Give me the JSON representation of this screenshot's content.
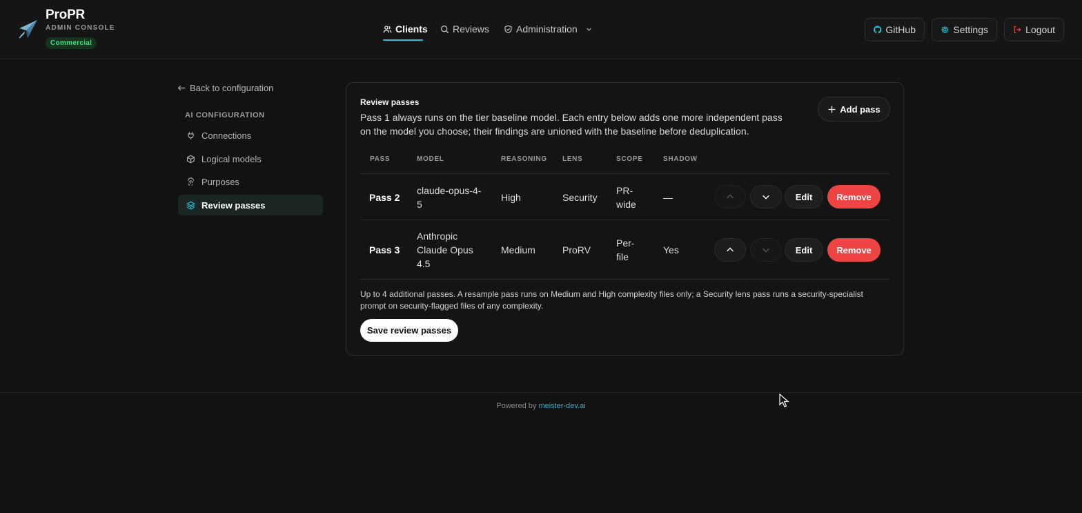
{
  "app": {
    "name": "ProPR",
    "subtitle": "ADMIN CONSOLE",
    "badge": "Commercial"
  },
  "nav": {
    "clients": "Clients",
    "reviews": "Reviews",
    "administration": "Administration",
    "active": "Clients"
  },
  "header_buttons": {
    "github": "GitHub",
    "settings": "Settings",
    "logout": "Logout"
  },
  "sidebar": {
    "back": "Back to configuration",
    "section": "AI CONFIGURATION",
    "items": [
      {
        "label": "Connections",
        "icon": "plug-icon"
      },
      {
        "label": "Logical models",
        "icon": "cube-icon"
      },
      {
        "label": "Purposes",
        "icon": "fingerprint-icon"
      },
      {
        "label": "Review passes",
        "icon": "layers-icon"
      }
    ],
    "active": "Review passes"
  },
  "card": {
    "title": "Review passes",
    "description": "Pass 1 always runs on the tier baseline model. Each entry below adds one more independent pass on the model you choose; their findings are unioned with the baseline before deduplication.",
    "add_button": "Add pass",
    "columns": [
      "PASS",
      "MODEL",
      "REASONING",
      "LENS",
      "SCOPE",
      "SHADOW"
    ],
    "rows": [
      {
        "pass": "Pass 2",
        "model": "claude-opus-4-5",
        "reasoning": "High",
        "lens": "Security",
        "scope": "PR-wide",
        "shadow": "—",
        "up_enabled": false,
        "down_enabled": true
      },
      {
        "pass": "Pass 3",
        "model": "Anthropic Claude Opus 4.5",
        "reasoning": "Medium",
        "lens": "ProRV",
        "scope": "Per-file",
        "shadow": "Yes",
        "up_enabled": true,
        "down_enabled": false
      }
    ],
    "edit_label": "Edit",
    "remove_label": "Remove",
    "footnote": "Up to 4 additional passes. A resample pass runs on Medium and High complexity files only; a Security lens pass runs a security-specialist prompt on security-flagged files of any complexity.",
    "save_button": "Save review passes"
  },
  "footer": {
    "prefix": "Powered by",
    "link": "meister-dev.ai"
  },
  "colors": {
    "accent": "#22c3d8",
    "danger": "#ef4444",
    "badge": "#4ade80",
    "background": "#121212"
  }
}
